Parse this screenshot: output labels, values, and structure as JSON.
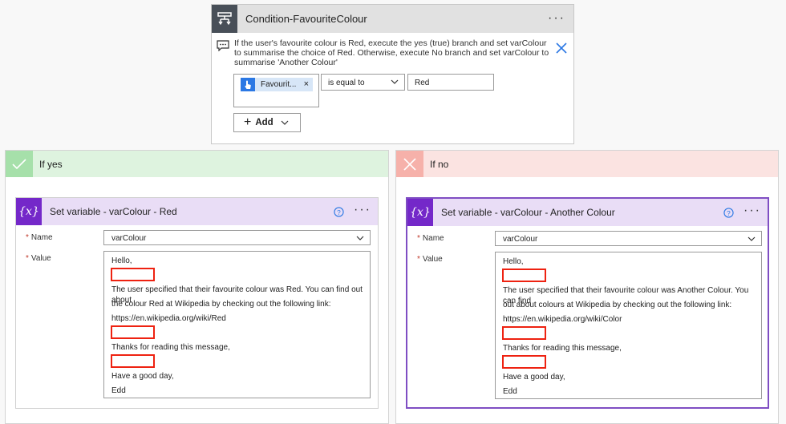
{
  "condition": {
    "title": "Condition-FavouriteColour",
    "menu": "···",
    "note": "If the user's favourite colour is Red, execute the yes (true) branch and set varColour to summarise the choice of Red. Otherwise, execute No branch and set varColour to summarise 'Another Colour'",
    "token_label": "Favourit...",
    "token_remove": "×",
    "operator": "is equal to",
    "compare_value": "Red",
    "add_label": "Add",
    "add_plus": "+"
  },
  "yes_branch": {
    "label": "If yes",
    "action": {
      "title": "Set variable - varColour - Red",
      "icon_text": "{x}",
      "menu": "···",
      "name_label": "Name",
      "name_value": "varColour",
      "value_label": "Value",
      "lines": [
        "Hello,",
        "The user specified that their favourite colour was Red. You can find out about",
        "the colour Red at Wikipedia by checking out the following link:",
        "https://en.wikipedia.org/wiki/Red",
        "Thanks for reading this message,",
        "Have a good day,",
        "Edd"
      ]
    }
  },
  "no_branch": {
    "label": "If no",
    "action": {
      "title": "Set variable - varColour - Another Colour",
      "icon_text": "{x}",
      "menu": "···",
      "name_label": "Name",
      "name_value": "varColour",
      "value_label": "Value",
      "lines": [
        "Hello,",
        "The user specified that their favourite colour was Another Colour. You can find",
        "out about colours at Wikipedia by checking out the following link:",
        "https://en.wikipedia.org/wiki/Color",
        "Thanks for reading this message,",
        "Have a good day,",
        "Edd"
      ]
    }
  },
  "colors": {
    "condition_icon_bg": "#484f58",
    "yes_header": "#def3df",
    "no_header": "#fbe3e1",
    "variable_icon_bg": "#7428c9",
    "variable_header": "#e9ddf6",
    "redaction": "#ee2211",
    "selected_border": "#7f4ec3"
  }
}
